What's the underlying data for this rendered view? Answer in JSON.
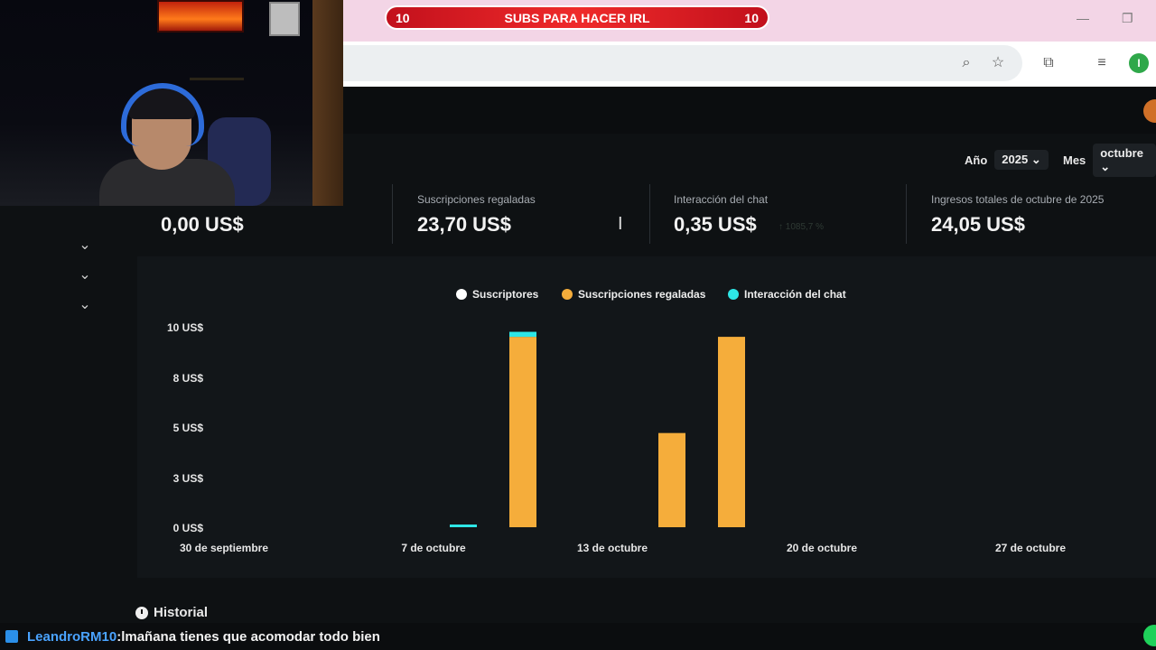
{
  "banner": {
    "left_count": "10",
    "text": "SUBS PARA HACER IRL",
    "right_count": "10",
    "color": "#e0141e"
  },
  "browser": {
    "profile_initial": "I"
  },
  "filters": {
    "year_label": "Año",
    "year_value": "2025",
    "month_label": "Mes",
    "month_value": "octubre"
  },
  "stats": [
    {
      "label": "",
      "value": "0,00 US$"
    },
    {
      "label": "Suscripciones regaladas",
      "value": "23,70 US$"
    },
    {
      "label": "Interacción del chat",
      "value": "0,35 US$",
      "ghost": "↑ 1085,7 %"
    },
    {
      "label": "Ingresos totales de octubre de 2025",
      "value": "24,05 US$"
    }
  ],
  "chart_data": {
    "type": "bar",
    "stacked": true,
    "legend_position": "top-center",
    "series": [
      {
        "name": "Suscriptores",
        "color": "#ffffff"
      },
      {
        "name": "Suscripciones regaladas",
        "color": "#f5ad3b"
      },
      {
        "name": "Interacción del chat",
        "color": "#2ee6e6"
      }
    ],
    "x_labels": [
      "30 de septiembre",
      "7 de octubre",
      "13 de octubre",
      "20 de octubre",
      "27 de octubre"
    ],
    "y_ticks": [
      "10 US$",
      "8 US$",
      "5 US$",
      "3 US$",
      "0 US$"
    ],
    "ylim": [
      0,
      10
    ],
    "bars": [
      {
        "date": "6 de octubre",
        "subs": 0,
        "gifted": 0,
        "chat": 0.1
      },
      {
        "date": "8 de octubre",
        "subs": 0,
        "gifted": 9.5,
        "chat": 0.25
      },
      {
        "date": "13 de octubre",
        "subs": 0,
        "gifted": 4.7,
        "chat": 0
      },
      {
        "date": "15 de octubre",
        "subs": 0,
        "gifted": 9.5,
        "chat": 0
      }
    ]
  },
  "history": {
    "title": "Historial"
  },
  "chat": {
    "user": "LeandroRM10",
    "separator": ": ",
    "message": "lmañana tienes que acomodar todo bien"
  }
}
